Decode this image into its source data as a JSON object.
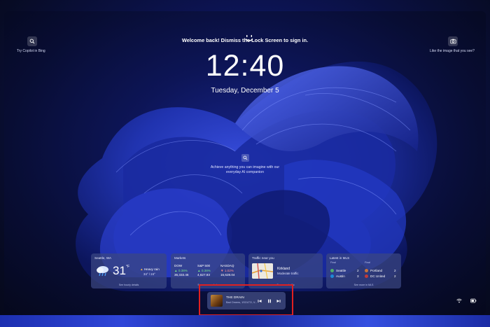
{
  "lockscreen": {
    "copilot_caption": "Try Copilot in Bing",
    "like_caption": "Like the image that you see?",
    "welcome": "Welcome back! Dismiss the Lock Screen to sign in.",
    "time": "12:40",
    "date": "Tuesday, December 5",
    "center_prompt_line1": "Achieve anything you can imagine with our",
    "center_prompt_line2": "everyday AI companion"
  },
  "widgets": {
    "weather": {
      "location": "Seattle, WA",
      "temperature": "31",
      "unit": "°F",
      "condition": "Heavy rain",
      "range": "34° / 24°",
      "footer": "See hourly details"
    },
    "markets": {
      "title": "Markets",
      "indices": [
        {
          "name": "DOW",
          "change": "▲ 0.38%",
          "value": "36,333.46"
        },
        {
          "name": "S&P 500",
          "change": "▲ 0.38%",
          "value": "4,627.93"
        },
        {
          "name": "NASDAQ",
          "change": "▼ 1.02%",
          "value": "15,628.04"
        }
      ],
      "footer": "See more markets"
    },
    "traffic": {
      "title": "Traffic near you",
      "place": "Kirkland",
      "level": "Moderate traffic",
      "footer": "See more traffic"
    },
    "mls": {
      "title": "Latest in MLS",
      "sub_left": "Final",
      "sub_right": "Final",
      "games": [
        {
          "team_a": "Seattle",
          "score_a": "2",
          "team_b": "Portland",
          "score_b": "2"
        },
        {
          "team_a": "Austin",
          "score_a": "3",
          "team_b": "DC United",
          "score_b": "2"
        }
      ],
      "footer": "See more in MLS"
    }
  },
  "media": {
    "song": "THE DRAIN",
    "artist": "Bad Omens, 1SOLTO, V..."
  },
  "colors": {
    "highlight": "#e02020",
    "market_up": "#6fe08a",
    "market_down": "#ff8f8f"
  }
}
